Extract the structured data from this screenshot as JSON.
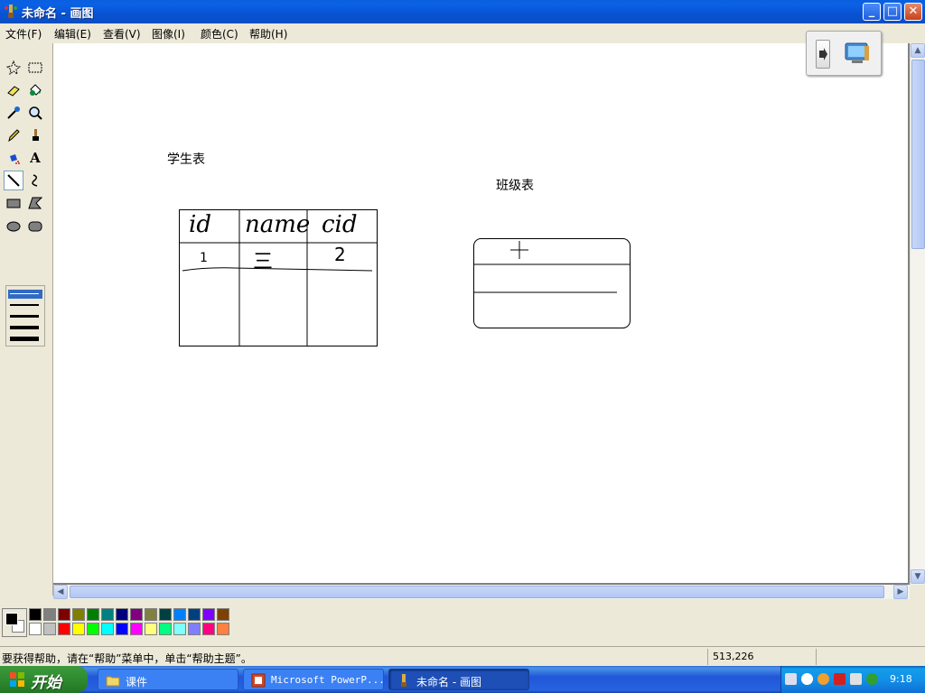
{
  "window": {
    "title": "未命名 - 画图",
    "controls": {
      "minimize": "_",
      "maximize": "□",
      "close": "✕"
    }
  },
  "menu": {
    "items": [
      "文件(F)",
      "编辑(E)",
      "查看(V)",
      "图像(I)",
      "颜色(C)",
      "帮助(H)"
    ]
  },
  "tools": {
    "names": [
      "free-form-select-icon",
      "rectangle-select-icon",
      "eraser-icon",
      "fill-bucket-icon",
      "color-picker-icon",
      "magnifier-icon",
      "pencil-icon",
      "brush-icon",
      "airbrush-icon",
      "text-icon",
      "line-icon",
      "curve-icon",
      "rectangle-icon",
      "polygon-icon",
      "ellipse-icon",
      "rounded-rectangle-icon"
    ],
    "text_tool_glyph": "A",
    "active": "line-icon"
  },
  "canvas": {
    "labels": {
      "student_table": "学生表",
      "class_table": "班级表"
    },
    "handwriting": {
      "col1": "id",
      "col2": "name",
      "col3": "cid",
      "row1_col1": "1",
      "row1_col2": "三",
      "row1_col3": "2"
    }
  },
  "palette": {
    "colors": [
      "#000000",
      "#808080",
      "#800000",
      "#808000",
      "#008000",
      "#008080",
      "#000080",
      "#800080",
      "#808040",
      "#004040",
      "#0080ff",
      "#004080",
      "#8000ff",
      "#804000",
      "#ffffff",
      "#c0c0c0",
      "#ff0000",
      "#ffff00",
      "#00ff00",
      "#00ffff",
      "#0000ff",
      "#ff00ff",
      "#ffff80",
      "#00ff80",
      "#80ffff",
      "#8080ff",
      "#ff0080",
      "#ff8040"
    ],
    "foreground": "#000000",
    "background": "#ffffff"
  },
  "status": {
    "help_text": "要获得帮助，请在“帮助”菜单中，单击“帮助主题”。",
    "coords": "513,226"
  },
  "taskbar": {
    "start_label": "开始",
    "tasks": [
      {
        "label": "课件",
        "icon": "folder-icon",
        "active": false
      },
      {
        "label": "Microsoft PowerP...",
        "icon": "powerpoint-icon",
        "active": false
      },
      {
        "label": "未命名 - 画图",
        "icon": "paint-icon",
        "active": true
      }
    ],
    "clock": "9:18"
  }
}
